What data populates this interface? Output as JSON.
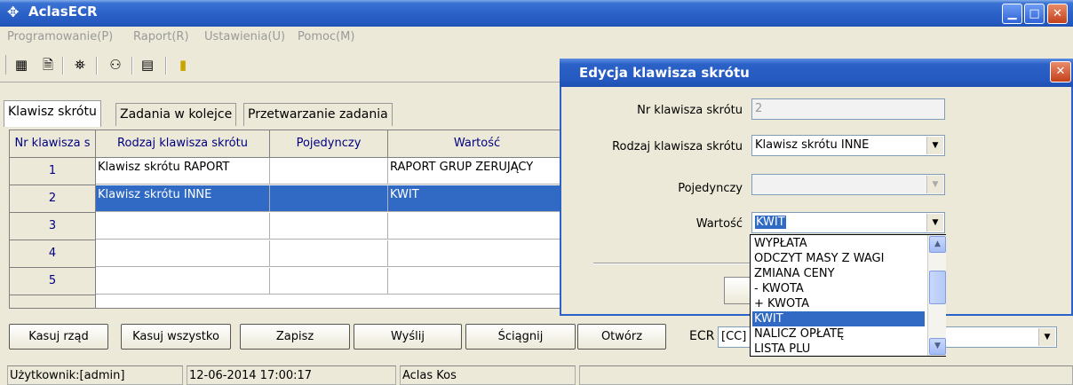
{
  "window": {
    "title": "AclasECR"
  },
  "menu": [
    "Programowanie(P)",
    "Raport(R)",
    "Ustawienia(U)",
    "Pomoc(M)"
  ],
  "tabs": [
    "Klawisz skrótu",
    "Zadania w kolejce",
    "Przetwarzanie zadania"
  ],
  "grid": {
    "headers": [
      "Nr klawisza s",
      "Rodzaj klawisza skrótu",
      "Pojedynczy",
      "Wartość"
    ],
    "rows": [
      {
        "nr": "1",
        "rodzaj": "Klawisz skrótu RAPORT",
        "pojedynczy": "",
        "wartosc": "RAPORT GRUP ZERUJĄCY",
        "selected": false
      },
      {
        "nr": "2",
        "rodzaj": "Klawisz skrótu INNE",
        "pojedynczy": "",
        "wartosc": "KWIT",
        "selected": true
      },
      {
        "nr": "3",
        "rodzaj": "",
        "pojedynczy": "",
        "wartosc": "",
        "selected": false
      },
      {
        "nr": "4",
        "rodzaj": "",
        "pojedynczy": "",
        "wartosc": "",
        "selected": false
      },
      {
        "nr": "5",
        "rodzaj": "",
        "pojedynczy": "",
        "wartosc": "",
        "selected": false
      }
    ]
  },
  "buttons": [
    "Kasuj rząd",
    "Kasuj wszystko",
    "Zapisz",
    "Wyślij",
    "Ściągnij",
    "Otwórz"
  ],
  "ecr": {
    "label": "ECR",
    "value": "[CC]"
  },
  "status": {
    "user": "Użytkownik:[admin]",
    "datetime": "12-06-2014 17:00:17",
    "name": "Aclas Kos"
  },
  "dialog": {
    "title": "Edycja klawisza skrótu",
    "fields": {
      "nr": {
        "label": "Nr klawisza skrótu",
        "value": "2"
      },
      "rodzaj": {
        "label": "Rodzaj klawisza skrótu",
        "value": "Klawisz skrótu INNE"
      },
      "pojedynczy": {
        "label": "Pojedynczy",
        "value": ""
      },
      "wartosc": {
        "label": "Wartość",
        "value": "KWIT"
      }
    },
    "dropdown_options": [
      "WYPŁATA",
      "ODCZYT MASY Z WAGI",
      "ZMIANA CENY",
      "- KWOTA",
      "+ KWOTA",
      "KWIT",
      "NALICZ OPŁATĘ",
      "LISTA PLU"
    ],
    "dropdown_selected": "KWIT"
  },
  "colors": {
    "titlebar": "#2b62c8",
    "selection": "#316ac5",
    "background": "#ece9d8"
  }
}
